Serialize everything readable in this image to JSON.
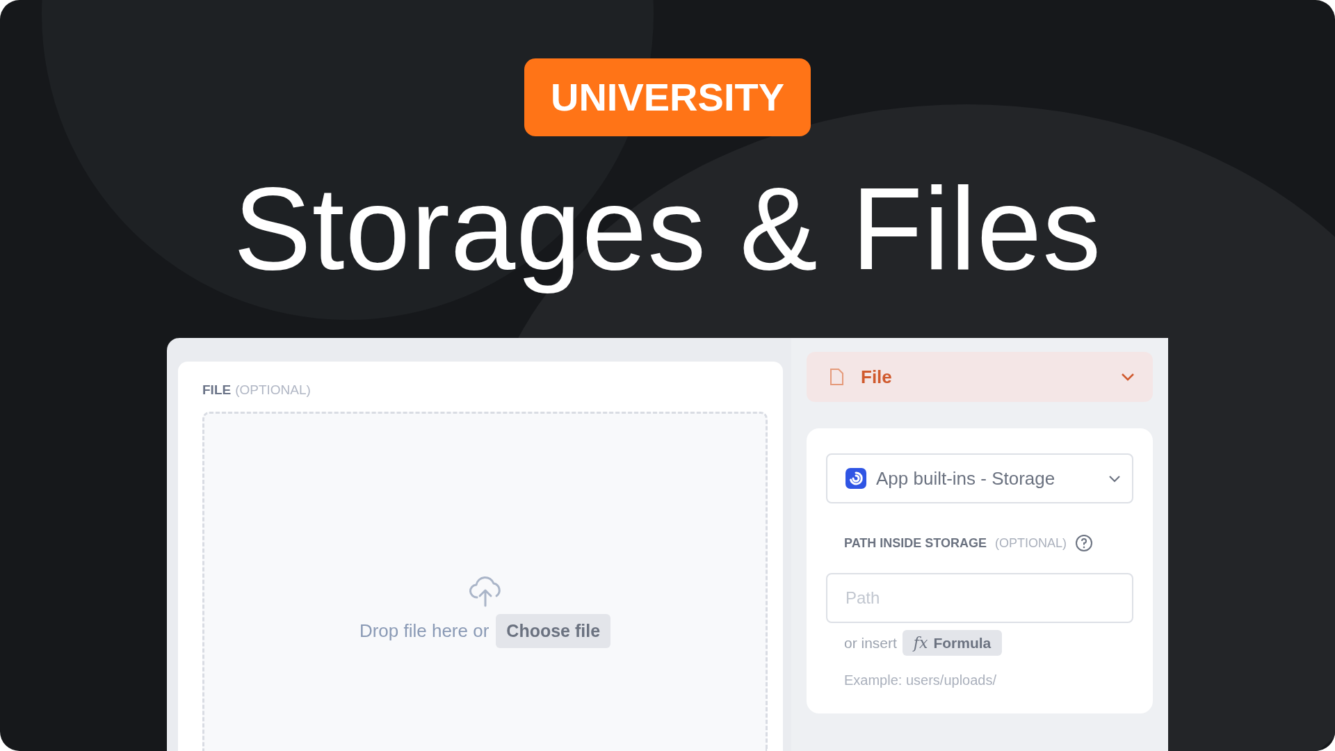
{
  "badge": "UNIVERSITY",
  "title": "Storages & Files",
  "file_panel": {
    "label": "FILE",
    "optional_note": "(OPTIONAL)",
    "drop_text": "Drop file here or",
    "choose_button": "Choose file"
  },
  "type_select": {
    "value": "File",
    "expanded": false
  },
  "storage_card": {
    "storage_select": {
      "value": "App built-ins - Storage"
    },
    "path_label": "PATH INSIDE STORAGE",
    "optional_note": "(OPTIONAL)",
    "path_field": {
      "placeholder": "Path"
    },
    "insert_text": "or insert",
    "formula_icon": "fx",
    "formula_button": "Formula",
    "example": "Example: users/uploads/"
  }
}
